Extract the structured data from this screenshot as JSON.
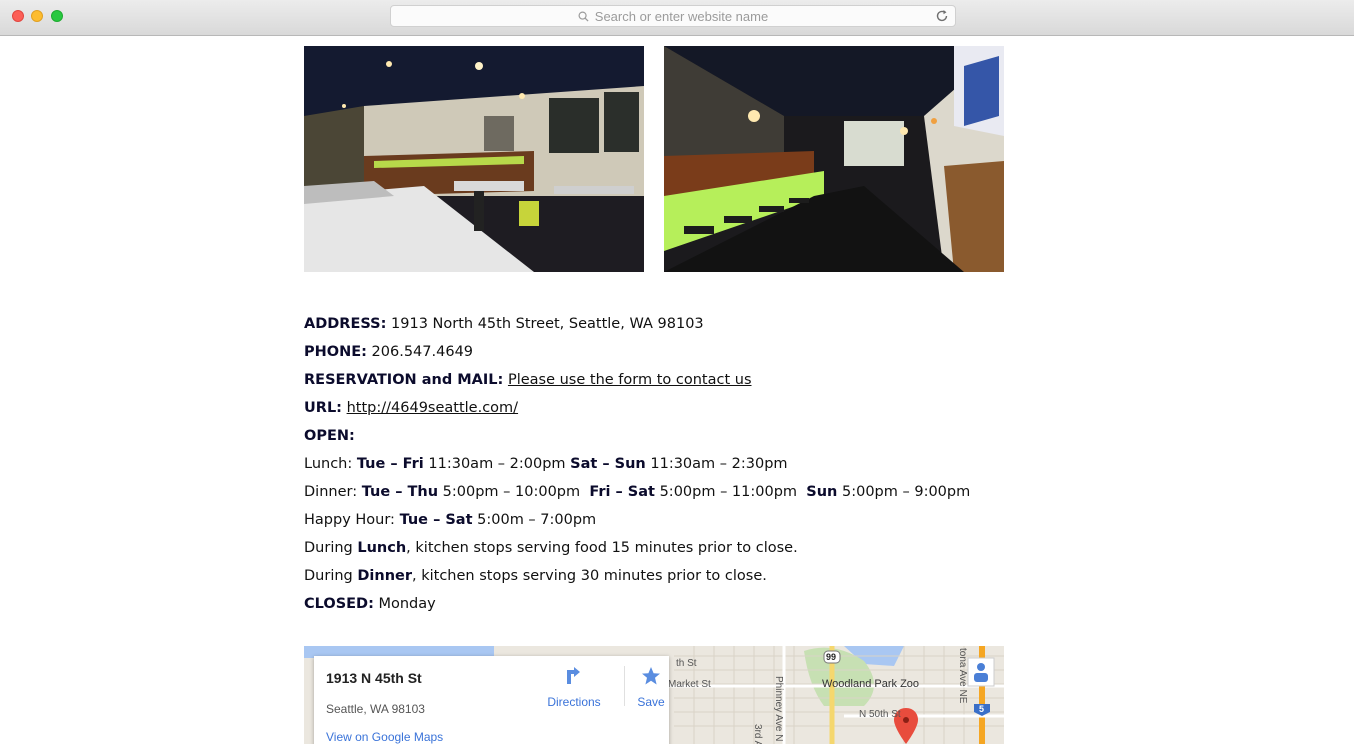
{
  "browser": {
    "search_placeholder": "Search or enter website name"
  },
  "photos": [
    {
      "name": "restaurant-interior-tables"
    },
    {
      "name": "restaurant-interior-bar"
    }
  ],
  "info": {
    "address_label": "ADDRESS:",
    "address_value": "1913 North 45th Street, Seattle, WA 98103",
    "phone_label": "PHONE:",
    "phone_value": "206.547.4649",
    "reservation_label": "RESERVATION and MAIL:",
    "reservation_link": "Please use the form to contact us",
    "url_label": "URL:",
    "url_link": "http://4649seattle.com/",
    "open_label": "OPEN:",
    "lunch": {
      "label": "Lunch:",
      "days1": "Tue – Fri",
      "hours1": "11:30am – 2:00pm",
      "days2": "Sat – Sun",
      "hours2": "11:30am – 2:30pm"
    },
    "dinner": {
      "label": "Dinner:",
      "days1": "Tue – Thu",
      "hours1": "5:00pm – 10:00pm",
      "days2": "Fri – Sat",
      "hours2": "5:00pm – 11:00pm",
      "days3": "Sun",
      "hours3": "5:00pm – 9:00pm"
    },
    "happy_hour": {
      "label": "Happy Hour:",
      "days": "Tue – Sat",
      "hours": "5:00m – 7:00pm"
    },
    "lunch_note": {
      "prefix": "During",
      "meal": "Lunch",
      "rest": ", kitchen stops serving food 15 minutes prior to close."
    },
    "dinner_note": {
      "prefix": "During",
      "meal": "Dinner",
      "rest": ", kitchen stops serving 30 minutes prior to close."
    },
    "closed_label": "CLOSED:",
    "closed_value": "Monday"
  },
  "map": {
    "place_title": "1913 N 45th St",
    "place_address": "Seattle, WA 98103",
    "view_link": "View on Google Maps",
    "directions_label": "Directions",
    "save_label": "Save",
    "streets": {
      "market": "Market St",
      "st_top": "th St",
      "phinney": "Phinney Ave N",
      "n50th": "N 50th St",
      "third": "3rd A",
      "tona": "tona Ave NE",
      "hwy99": "99",
      "i5": "5"
    },
    "poi": "Woodland Park Zoo"
  },
  "colors": {
    "label_text": "#0b0b2c",
    "link_blue": "#3a73d9",
    "pin_red": "#e84c3d",
    "highway_yellow": "#f2c94c"
  }
}
